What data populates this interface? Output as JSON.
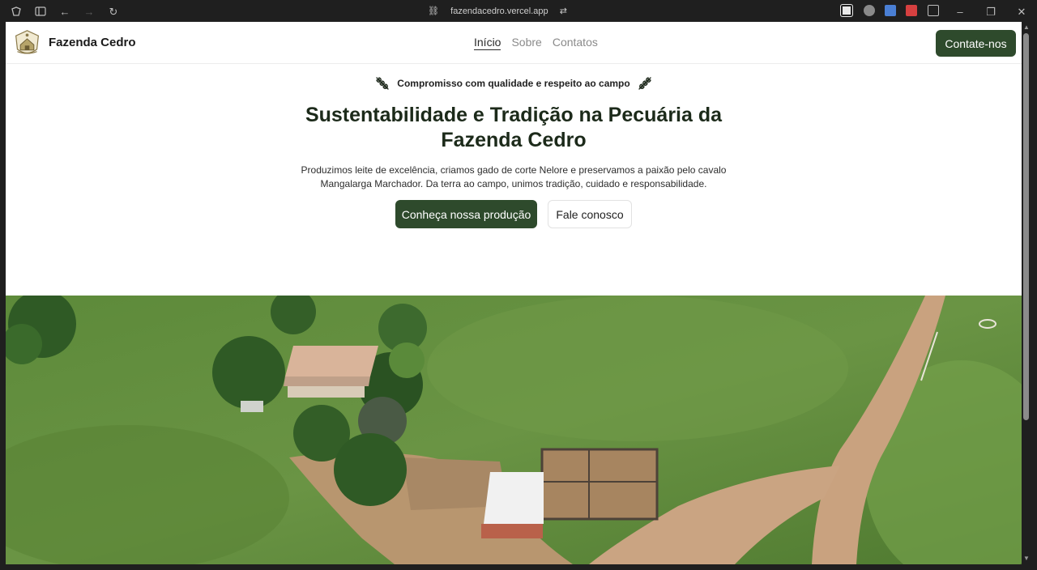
{
  "browser": {
    "url": "fazendacedro.vercel.app"
  },
  "header": {
    "brand": "Fazenda Cedro",
    "nav": [
      {
        "label": "Início",
        "active": true
      },
      {
        "label": "Sobre",
        "active": false
      },
      {
        "label": "Contatos",
        "active": false
      }
    ],
    "cta": "Contate-nos"
  },
  "hero": {
    "tagline": "Compromisso com qualidade e respeito ao campo",
    "title": "Sustentabilidade e Tradição na Pecuária da Fazenda Cedro",
    "description": "Produzimos leite de excelência, criamos gado de corte Nelore e preservamos a paixão pelo cavalo Mangalarga Marchador. Da terra ao campo, unimos tradição, cuidado e responsabilidade.",
    "primary_button": "Conheça nossa produção",
    "secondary_button": "Fale conosco"
  },
  "colors": {
    "primary": "#2e4a2c",
    "grass": "#5f8a3c",
    "dirt": "#c9a27f"
  }
}
